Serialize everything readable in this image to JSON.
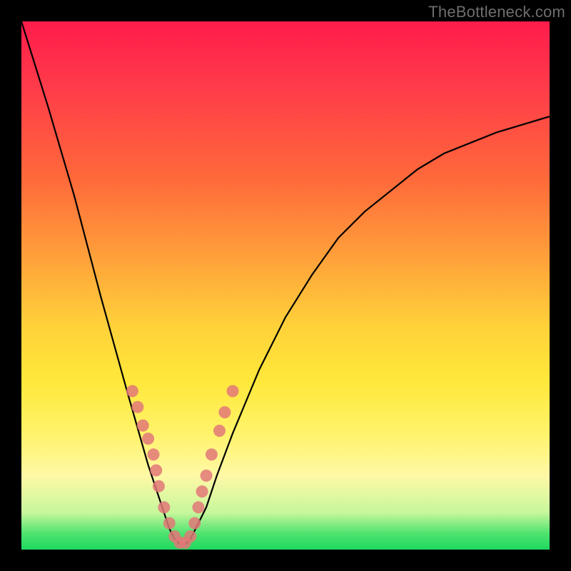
{
  "watermark": "TheBottleneck.com",
  "chart_data": {
    "type": "line",
    "title": "",
    "xlabel": "",
    "ylabel": "",
    "xlim": [
      0,
      100
    ],
    "ylim": [
      0,
      100
    ],
    "series": [
      {
        "name": "bottleneck-curve",
        "x": [
          0,
          5,
          10,
          15,
          20,
          22,
          24,
          26,
          27,
          28,
          29,
          30,
          31,
          32,
          33,
          35,
          37,
          40,
          45,
          50,
          55,
          60,
          65,
          70,
          75,
          80,
          85,
          90,
          95,
          100
        ],
        "y": [
          100,
          84,
          67,
          48,
          30,
          23,
          16,
          10,
          7,
          4,
          2,
          1,
          1,
          2,
          4,
          8,
          14,
          22,
          34,
          44,
          52,
          59,
          64,
          68,
          72,
          75,
          77,
          79,
          80.5,
          82
        ]
      }
    ],
    "markers": {
      "name": "scatter-points",
      "color": "#e27878",
      "points": [
        {
          "x": 21,
          "y": 30
        },
        {
          "x": 22,
          "y": 27
        },
        {
          "x": 23,
          "y": 23.5
        },
        {
          "x": 24,
          "y": 21
        },
        {
          "x": 25,
          "y": 18
        },
        {
          "x": 25.5,
          "y": 15
        },
        {
          "x": 26,
          "y": 12
        },
        {
          "x": 27,
          "y": 8
        },
        {
          "x": 28,
          "y": 5
        },
        {
          "x": 29,
          "y": 2.5
        },
        {
          "x": 30,
          "y": 1.3
        },
        {
          "x": 31,
          "y": 1.3
        },
        {
          "x": 32,
          "y": 2.5
        },
        {
          "x": 32.8,
          "y": 5
        },
        {
          "x": 33.5,
          "y": 8
        },
        {
          "x": 34.2,
          "y": 11
        },
        {
          "x": 35,
          "y": 14
        },
        {
          "x": 36,
          "y": 18
        },
        {
          "x": 37.5,
          "y": 22.5
        },
        {
          "x": 38.5,
          "y": 26
        },
        {
          "x": 40,
          "y": 30
        }
      ]
    }
  }
}
